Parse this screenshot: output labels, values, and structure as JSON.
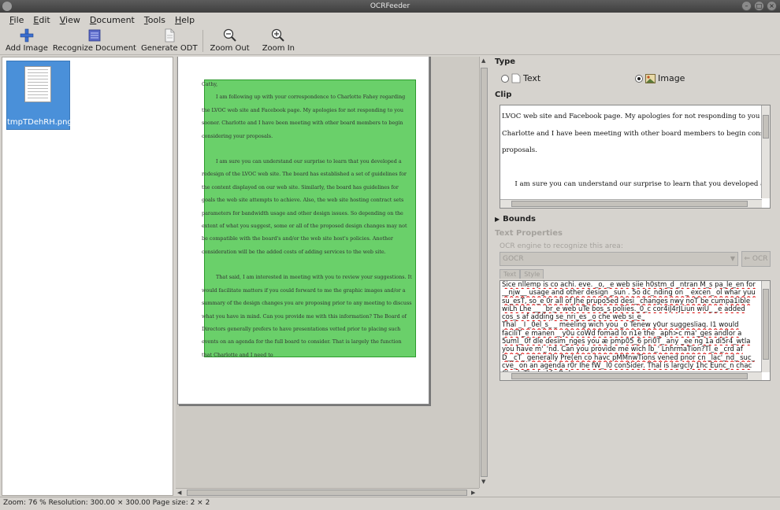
{
  "window": {
    "title": "OCRFeeder"
  },
  "menu": [
    {
      "label": "File",
      "mnemonic": "F",
      "rest": "ile"
    },
    {
      "label": "Edit",
      "mnemonic": "E",
      "rest": "dit"
    },
    {
      "label": "View",
      "mnemonic": "V",
      "rest": "iew"
    },
    {
      "label": "Document",
      "mnemonic": "D",
      "rest": "ocument"
    },
    {
      "label": "Tools",
      "mnemonic": "T",
      "rest": "ools"
    },
    {
      "label": "Help",
      "mnemonic": "H",
      "rest": "elp"
    }
  ],
  "toolbar": {
    "add_image": "Add Image",
    "recognize_document": "Recognize Document",
    "generate_odt": "Generate ODT",
    "zoom_out": "Zoom Out",
    "zoom_in": "Zoom In"
  },
  "thumbnails": [
    {
      "label": "tmpTDehRH.png"
    }
  ],
  "document": {
    "line_first": "Cathy,",
    "paragraphs": [
      "I am following up with your correspondence to Charlotte Fahey regarding the LVOC web site and Facebook page. My apologies for not responding to you sooner. Charlotte and I have been meeting with other board members to begin considering your proposals.",
      "I am sure you can understand our surprise to learn that you developed a redesign of the LVOC web site. The board has established a set of guidelines for the content displayed on our web site. Similarly, the board has guidelines for goals the web site attempts to achieve. Also, the web site hosting contract sets parameters for bandwidth usage and other design issues. So depending on the extent of what you suggest, some or all of the proposed design changes may not be compatible with the board's and/or the web site host's policies. Another consideration will be the added costs of adding services to the web site.",
      "That said, I am interested in meeting with you to review your suggestions. It would facilitate matters if you could forward to me the graphic images and/or a summary of the design changes you are proposing prior to any meeting to discuss what you have in mind. Can you provide me with this information? The Board of Directors generally prefers to have presentations vetted prior to placing such events on an agenda for the full board to consider. That is largely the function that Charlotte and I need to"
    ]
  },
  "right_panel": {
    "type_heading": "Type",
    "type_text": "Text",
    "type_image": "Image",
    "selected_type": "text",
    "clip_heading": "Clip",
    "clip_lines": [
      "LVOC web site and Facebook page. My apologies for not responding to you sooner.",
      "Charlotte and I have been meeting with other board members to begin considering yo",
      "proposals.",
      "",
      "      I am sure you can understand our surprise to learn that you developed a redesig"
    ],
    "bounds_heading": "Bounds",
    "text_properties_heading": "Text Properties",
    "ocr_engine_label": "OCR engine to recognize this area:",
    "ocr_engine_value": "GOCR",
    "ocr_button": "OCR",
    "tab_text": "Text",
    "tab_style": "Style",
    "ocr_lines": [
      "Sice nllemp is co achi. eve. _o, _e web siie h0stm_d _ntran M_s pa_le_en for",
      "__njw__ usage and other design _sun . 5o dc_nding on _ excen_ ol whar yuu",
      "su_esT, so_e 0r all of Jhe prupo5ed desi_ changes nwy noT be cumpa1ible",
      "wiLh Lhe __ _br_e web uTe bos_s poliies._0_c cor4iJ4rJLiun wiU_ _e added",
      "cos_s af adding se_nri_es _o che web si_e_",
      "Thal _ I _0el_s_ _ meeling wich you _o Tenew y0ur suggesliaq. I1 would",
      "faciliT_e manen _ y0u coWd fomad lo n1e the _aph>c ma'_ges andlor a",
      "5uml_ 0f dle desim_nges you æ pmp05_6 pri0T_ any _ee ng 1a di5r4_wtla",
      "you have m'_'nd. Can you provide me wich lb_' LnhrmaTion?Tl_e _crd af",
      "D__cT_ generally Pre(en co havc pMMnwTions vened pnor cn _lac'_nd_ suc_",
      "cve_ on an agenda r0r Ihe fW_ l0 conSider. Thal is largcly 1hc Eunc_n chac",
      "CharloTLe Ind f nRrd ro"
    ]
  },
  "status": {
    "text": "Zoom: 76 % Resolution: 300.00 × 300.00 Page size: 2 × 2"
  }
}
